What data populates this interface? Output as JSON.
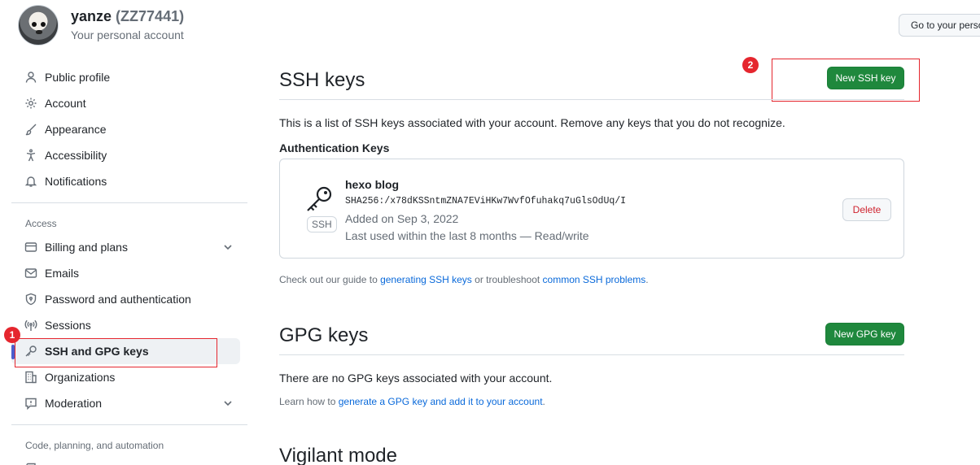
{
  "header": {
    "username": "yanze",
    "handle": "(ZZ77441)",
    "subtitle": "Your personal account",
    "goto_button": "Go to your personal profile"
  },
  "sidebar": {
    "items_top": [
      {
        "label": "Public profile",
        "icon": "person-icon"
      },
      {
        "label": "Account",
        "icon": "gear-icon"
      },
      {
        "label": "Appearance",
        "icon": "paintbrush-icon"
      },
      {
        "label": "Accessibility",
        "icon": "accessibility-icon"
      },
      {
        "label": "Notifications",
        "icon": "bell-icon"
      }
    ],
    "access_heading": "Access",
    "items_access": [
      {
        "label": "Billing and plans",
        "icon": "credit-card-icon"
      },
      {
        "label": "Emails",
        "icon": "mail-icon"
      },
      {
        "label": "Password and authentication",
        "icon": "shield-lock-icon"
      },
      {
        "label": "Sessions",
        "icon": "broadcast-icon"
      },
      {
        "label": "SSH and GPG keys",
        "icon": "key-icon"
      },
      {
        "label": "Organizations",
        "icon": "organization-icon"
      },
      {
        "label": "Moderation",
        "icon": "report-icon"
      }
    ],
    "code_heading": "Code, planning, and automation"
  },
  "annotations": {
    "one": "1",
    "two": "2",
    "color": "#e5262e"
  },
  "ssh": {
    "title": "SSH keys",
    "new_button": "New SSH key",
    "description": "This is a list of SSH keys associated with your account. Remove any keys that you do not recognize.",
    "auth_heading": "Authentication Keys",
    "key": {
      "type_label": "SSH",
      "title": "hexo blog",
      "fingerprint": "SHA256:/x78dKSSntmZNA7EViHKw7WvfOfuhakq7uGlsOdUq/I",
      "added": "Added on Sep 3, 2022",
      "last_used": "Last used within the last 8 months — Read/write",
      "delete_button": "Delete"
    },
    "guide_prefix": "Check out our guide to ",
    "guide_link1": "generating SSH keys",
    "guide_middle": " or troubleshoot ",
    "guide_link2": "common SSH problems",
    "guide_suffix": "."
  },
  "gpg": {
    "title": "GPG keys",
    "new_button": "New GPG key",
    "empty": "There are no GPG keys associated with your account.",
    "learn_prefix": "Learn how to ",
    "learn_link": "generate a GPG key and add it to your account",
    "learn_suffix": "."
  },
  "vigilant": {
    "title": "Vigilant mode"
  },
  "colors": {
    "accent_green": "#1f883d",
    "link_blue": "#0969da",
    "danger": "#cf222e",
    "active_indicator": "#4b5dcc"
  }
}
